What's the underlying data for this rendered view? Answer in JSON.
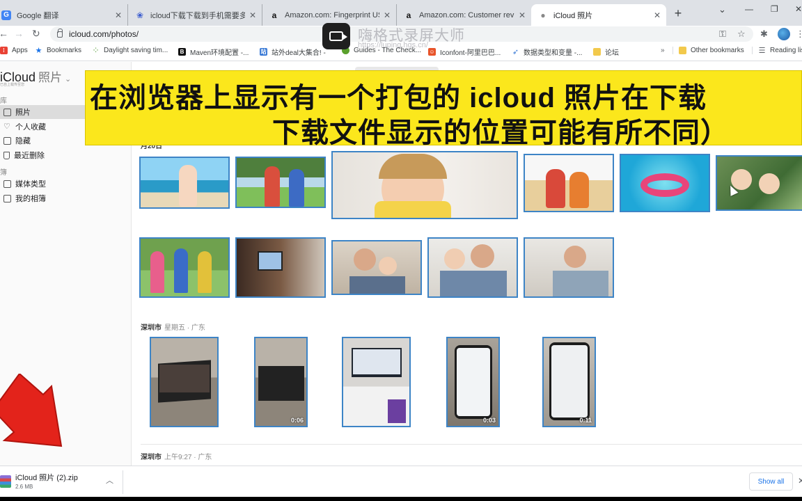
{
  "tabs": [
    {
      "title": "Google 翻译",
      "icon": "google-translate-icon",
      "color": "#4285f4"
    },
    {
      "title": "icloud下载下载到手机需要多久",
      "icon": "paw-icon",
      "color": "#3b5ccf"
    },
    {
      "title": "Amazon.com: Fingerprint USB 3",
      "icon": "amazon-icon",
      "color": "#111111"
    },
    {
      "title": "Amazon.com: Customer reviews",
      "icon": "amazon-icon",
      "color": "#111111"
    },
    {
      "title": "iCloud 照片",
      "icon": "apple-icon",
      "color": "#888888",
      "active": true
    }
  ],
  "toolbar": {
    "url": "icloud.com/photos/"
  },
  "bookmarks": [
    {
      "label": "Apps",
      "icon": "apps-grid-icon",
      "color": "#e94235"
    },
    {
      "label": "Bookmarks",
      "icon": "star-icon",
      "color": "#1a73e8"
    },
    {
      "label": "Daylight saving tim...",
      "icon": "dots-icon",
      "color": "#6aa84f"
    },
    {
      "label": "Maven环境配置 -...",
      "icon": "b-icon",
      "color": "#111111"
    },
    {
      "label": "站外deal大集合! -",
      "icon": "deal-icon",
      "color": "#3b7bd6"
    },
    {
      "label": "Guides - The Check...",
      "icon": "guides-icon",
      "color": "#5aa02c"
    },
    {
      "label": "Iconfont-阿里巴巴...",
      "icon": "iconfont-icon",
      "color": "#e8542a"
    },
    {
      "label": "数据类型和变量 -...",
      "icon": "rocket-icon",
      "color": "#3b7bd6"
    },
    {
      "label": "论坛",
      "icon": "folder-icon",
      "color": "#f2c94c"
    },
    {
      "label": "Other bookmarks",
      "icon": "folder-icon",
      "color": "#f2c94c"
    },
    {
      "label": "Reading lis",
      "icon": "reading-list-icon",
      "color": "#5f6368"
    }
  ],
  "more_bookmarks": "»",
  "recorder": {
    "title": "嗨格式录屏大师",
    "url": "https://luping.hgs.cn/"
  },
  "sidebar": {
    "brand": "iCloud",
    "brand_app": "照片",
    "brand_sub": "已自上载传至您",
    "section_library": "库",
    "section_albums": "簿",
    "items": [
      {
        "label": "照片",
        "icon": "photos-icon",
        "selected": true
      },
      {
        "label": "个人收藏",
        "icon": "heart-icon"
      },
      {
        "label": "隐藏",
        "icon": "hidden-icon"
      },
      {
        "label": "最近删除",
        "icon": "trash-icon"
      },
      {
        "label": "媒体类型",
        "icon": "media-types-icon"
      },
      {
        "label": "我的相簿",
        "icon": "my-albums-icon"
      }
    ]
  },
  "banner": {
    "line1": "在浏览器上显示有一个打包的 icloud 照片在下载",
    "line2": "下载文件显示的位置可能有所不同）"
  },
  "sections": [
    {
      "place": "月20日",
      "sub": ""
    },
    {
      "place": "深圳市",
      "sub": "星期五 · 广东"
    },
    {
      "place": "深圳市",
      "sub": "上午9:27 · 广东"
    }
  ],
  "video_durations": [
    "0:06",
    "0:03",
    "0:11"
  ],
  "download": {
    "filename": "iCloud 照片 (2).zip",
    "size": "2.6 MB",
    "show_all": "Show all"
  },
  "colors": {
    "accent": "#1a73e8",
    "selection_border": "#3d84c6",
    "banner": "#fbe71c",
    "arrow": "#e3231b"
  }
}
